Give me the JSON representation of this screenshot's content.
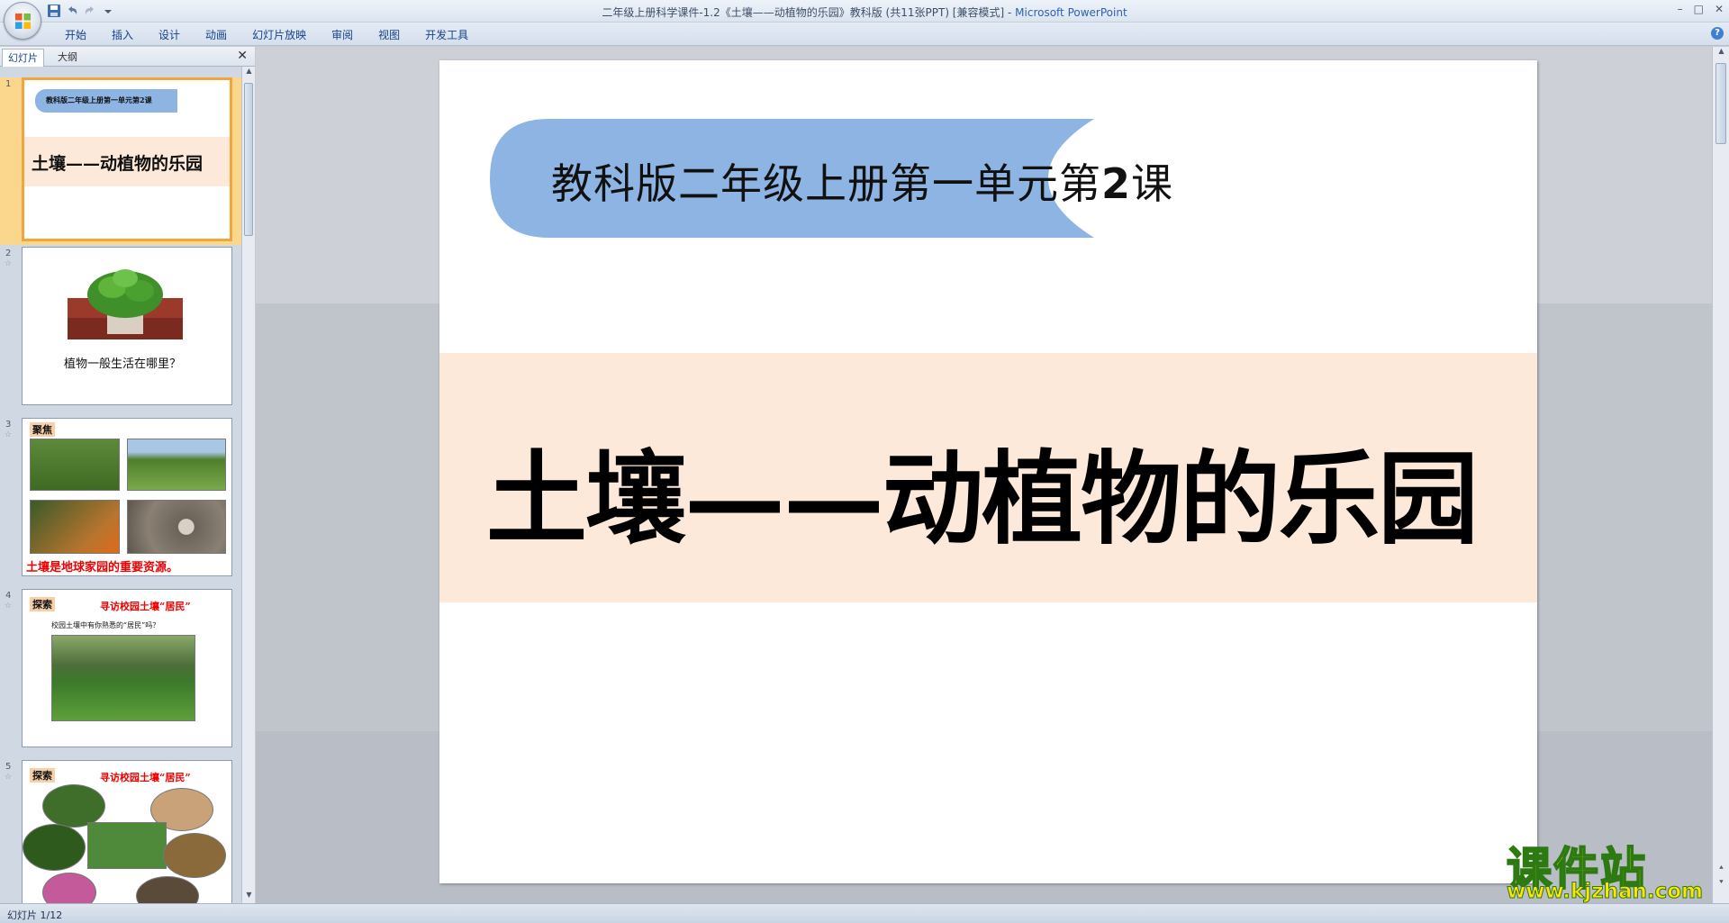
{
  "window": {
    "title": "二年级上册科学课件-1.2《土壤——动植物的乐园》教科版 (共11张PPT) [兼容模式]",
    "title_separator": " - ",
    "app_name": "Microsoft PowerPoint",
    "controls": [
      "–",
      "□",
      "✕"
    ]
  },
  "ribbon": {
    "tabs": [
      "开始",
      "插入",
      "设计",
      "动画",
      "幻灯片放映",
      "审阅",
      "视图",
      "开发工具"
    ]
  },
  "left_pane": {
    "tabs": [
      "幻灯片",
      "大纲"
    ],
    "close": "✕",
    "thumbnails": [
      {
        "num": "1",
        "subtitle": "教科版二年级上册第一单元第2课",
        "title": "土壤——动植物的乐园"
      },
      {
        "num": "2",
        "star": "☆",
        "caption": "植物一般生活在哪里？"
      },
      {
        "num": "3",
        "star": "☆",
        "tag": "聚焦",
        "caption": "土壤是地球家园的重要资源。"
      },
      {
        "num": "4",
        "star": "☆",
        "tag": "探索",
        "heading": "寻访校园土壤“居民”",
        "caption": "校园土壤中有你熟悉的“居民”吗？"
      },
      {
        "num": "5",
        "star": "☆",
        "tag": "探索",
        "heading": "寻访校园土壤“居民”"
      }
    ]
  },
  "slide": {
    "subtitle": "教科版二年级上册第一单元第",
    "subtitle_num": "2",
    "subtitle_end": "课",
    "title": "土壤——动植物的乐园",
    "colors": {
      "banner": "#8eb4e3",
      "band": "#fde9d9"
    }
  },
  "status": {
    "text": "幻灯片 1/12"
  },
  "watermark": {
    "title": "课件站",
    "url": "www.kjzhan.com"
  }
}
